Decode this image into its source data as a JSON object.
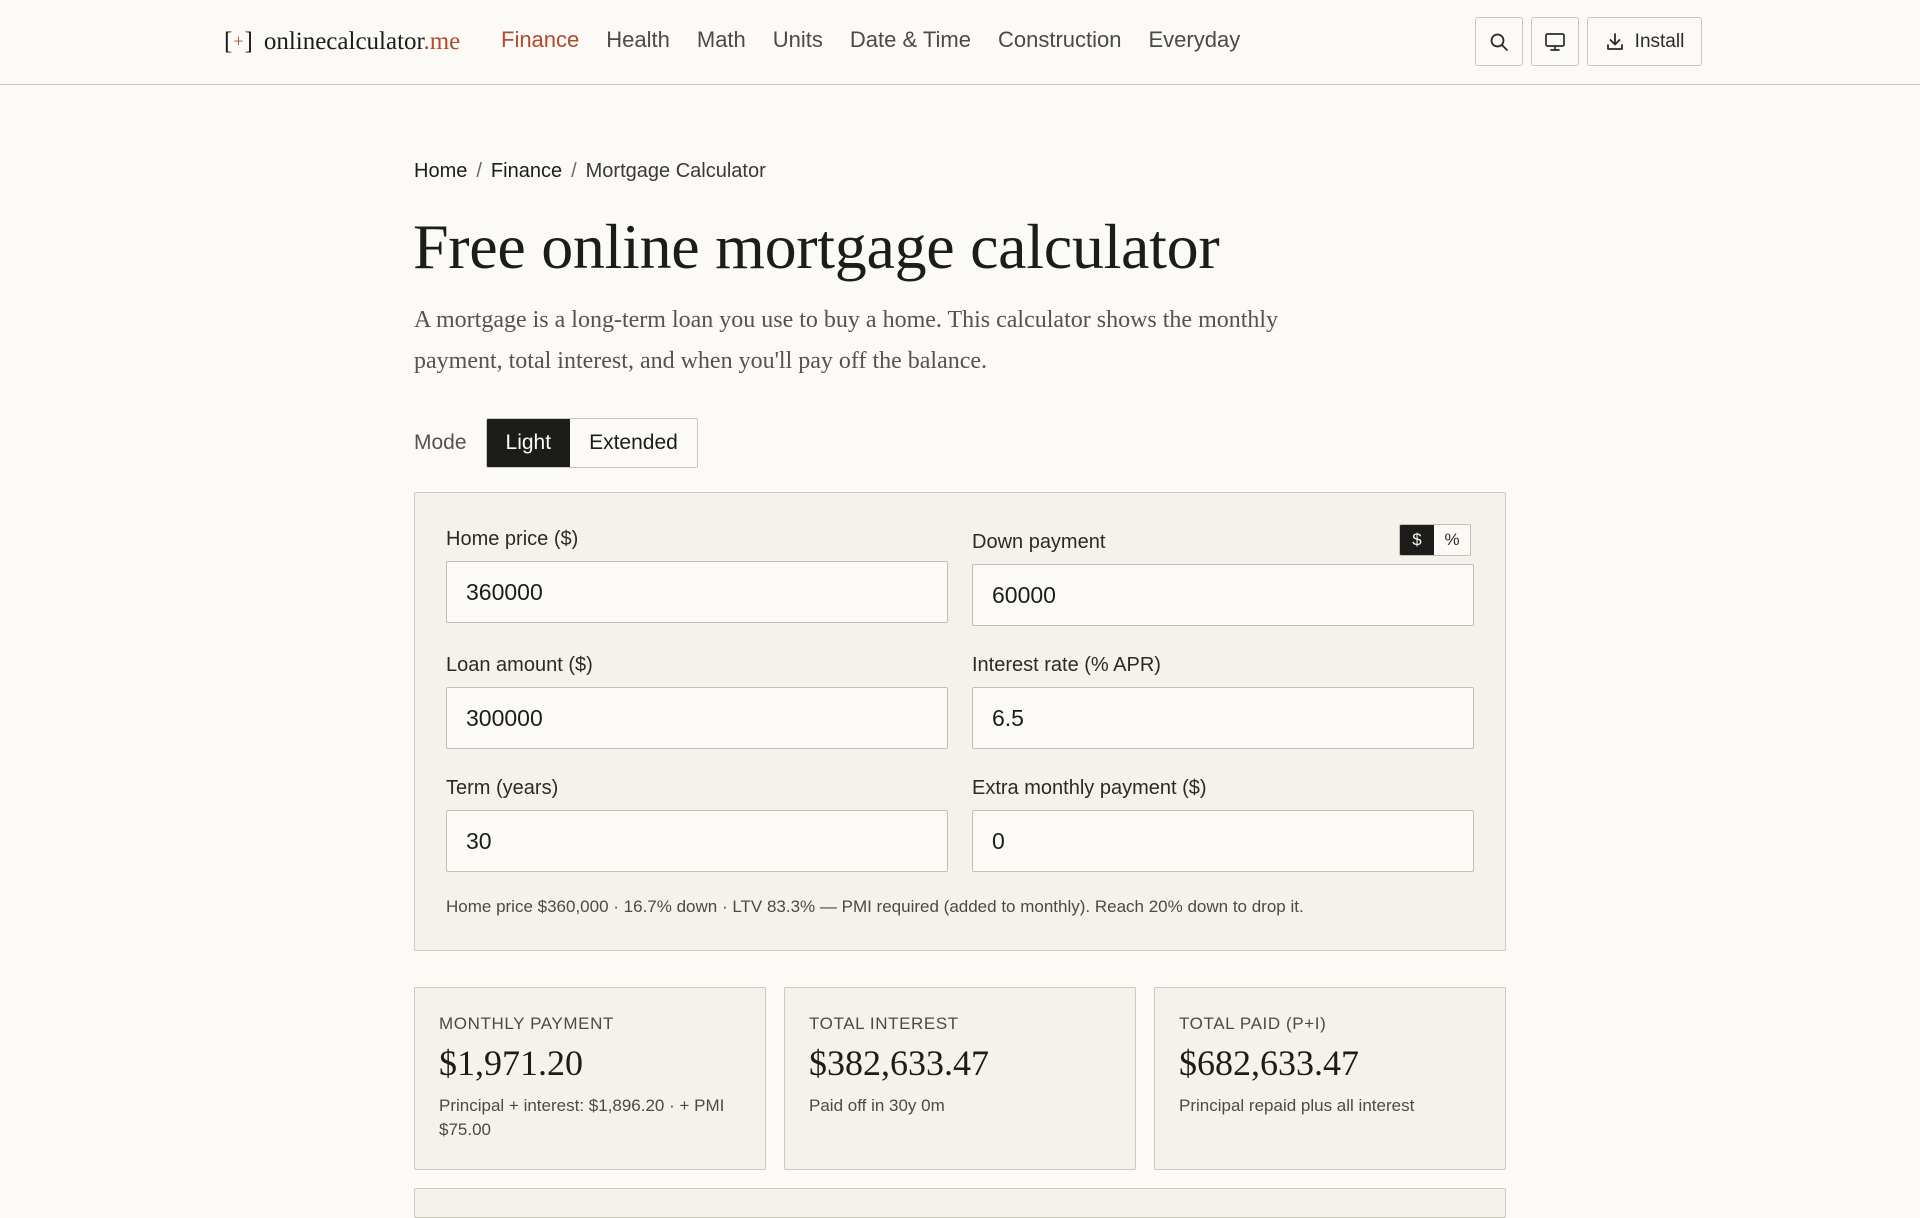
{
  "brand": {
    "name": "onlinecalculator",
    "tld": ".me",
    "mark_left": "[",
    "mark_plus": "+",
    "mark_right": "]"
  },
  "nav": {
    "items": [
      {
        "label": "Finance",
        "active": true
      },
      {
        "label": "Health"
      },
      {
        "label": "Math"
      },
      {
        "label": "Units"
      },
      {
        "label": "Date & Time"
      },
      {
        "label": "Construction"
      },
      {
        "label": "Everyday"
      }
    ],
    "install_label": "Install",
    "icons": [
      "search-icon",
      "monitor-icon",
      "download-icon"
    ]
  },
  "breadcrumb": {
    "home": "Home",
    "section": "Finance",
    "current": "Mortgage Calculator",
    "separator": "/"
  },
  "page": {
    "title": "Free online mortgage calculator",
    "intro": "A mortgage is a long-term loan you use to buy a home. This calculator shows the monthly payment, total interest, and when you'll pay off the balance."
  },
  "mode": {
    "label": "Mode",
    "options": [
      "Light",
      "Extended"
    ],
    "selected": "Light"
  },
  "form": {
    "home_price": {
      "label": "Home price ($)",
      "value": "360000"
    },
    "down_payment": {
      "label": "Down payment",
      "value": "60000",
      "units": [
        "$",
        "%"
      ],
      "selected_unit": "$"
    },
    "loan_amount": {
      "label": "Loan amount ($)",
      "value": "300000"
    },
    "interest_rate": {
      "label": "Interest rate (% APR)",
      "value": "6.5"
    },
    "term": {
      "label": "Term (years)",
      "value": "30"
    },
    "extra_payment": {
      "label": "Extra monthly payment ($)",
      "value": "0"
    },
    "note": "Home price $360,000 · 16.7% down · LTV 83.3% — PMI required (added to monthly). Reach 20% down to drop it."
  },
  "results": {
    "monthly": {
      "label": "MONTHLY PAYMENT",
      "value": "$1,971.20",
      "note": "Principal + interest: $1,896.20 · + PMI $75.00"
    },
    "interest": {
      "label": "TOTAL INTEREST",
      "value": "$382,633.47",
      "note": "Paid off in 30y 0m"
    },
    "total": {
      "label": "TOTAL PAID (P+I)",
      "value": "$682,633.47",
      "note": "Principal repaid plus all interest"
    }
  },
  "colors": {
    "accent": "#b3492d",
    "background": "#fbfaf6",
    "card": "#f4f2ea",
    "ink": "#1c1c1a"
  }
}
